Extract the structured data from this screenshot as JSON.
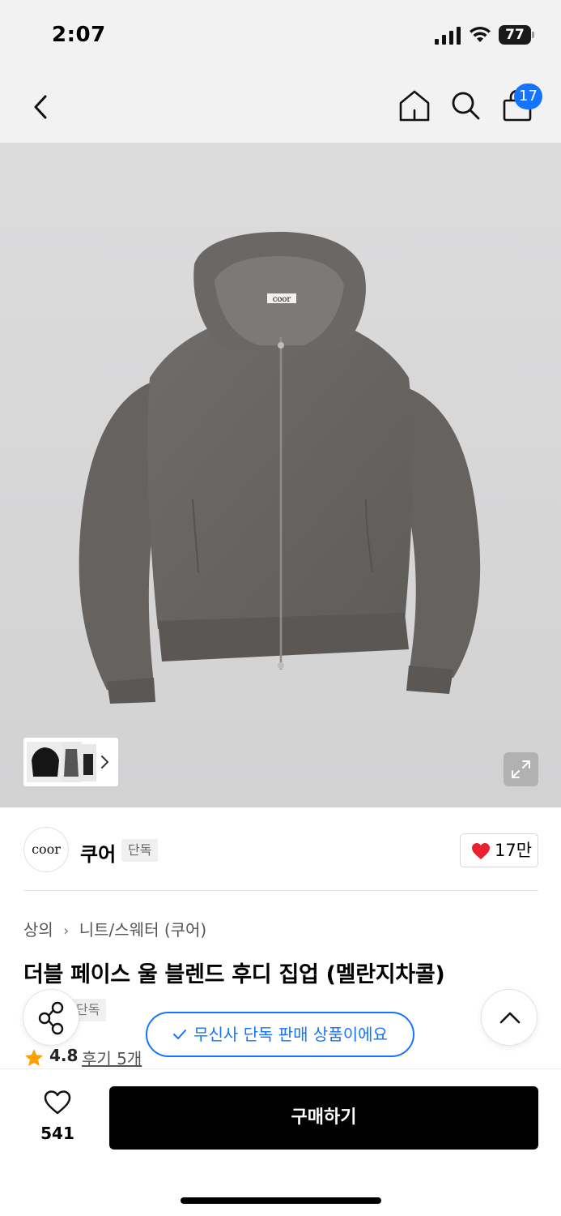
{
  "status_bar": {
    "time": "2:07",
    "battery": "77"
  },
  "nav": {
    "cart_count": "17"
  },
  "product_image": {
    "label": "coor"
  },
  "brand": {
    "logo_text": "coor",
    "name": "쿠어",
    "tag": "단독",
    "likes": "17만"
  },
  "breadcrumb": [
    "상의",
    "니트/스웨터 (쿠어)"
  ],
  "product": {
    "title": "더블 페이스 울 블렌드 후디 집업 (멜란지차콜)",
    "tag": "단독"
  },
  "notice": {
    "text": "무신사 단독 판매 상품이에요"
  },
  "rating": {
    "value": "4.8",
    "reviews": "후기 5개"
  },
  "bottom": {
    "wish_count": "541",
    "buy_label": "구매하기"
  },
  "colors": {
    "accent": "#1673ff",
    "heart": "#e8222e",
    "star": "#ff9f00",
    "buy": "#000000"
  }
}
